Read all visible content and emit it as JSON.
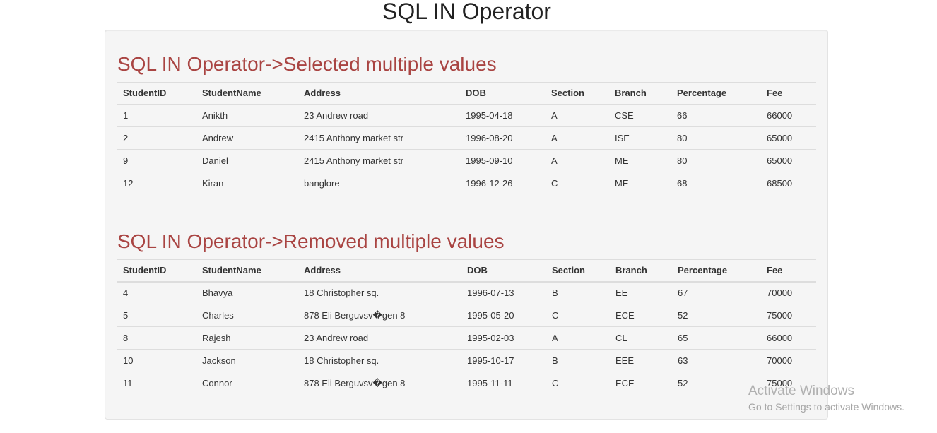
{
  "page": {
    "title": "SQL IN Operator"
  },
  "selected": {
    "heading": "SQL IN Operator->Selected multiple values",
    "columns": [
      "StudentID",
      "StudentName",
      "Address",
      "DOB",
      "Section",
      "Branch",
      "Percentage",
      "Fee"
    ],
    "rows": [
      [
        "1",
        "Anikth",
        "23 Andrew road",
        "1995-04-18",
        "A",
        "CSE",
        "66",
        "66000"
      ],
      [
        "2",
        "Andrew",
        "2415 Anthony market str",
        "1996-08-20",
        "A",
        "ISE",
        "80",
        "65000"
      ],
      [
        "9",
        "Daniel",
        "2415 Anthony market str",
        "1995-09-10",
        "A",
        "ME",
        "80",
        "65000"
      ],
      [
        "12",
        "Kiran",
        "banglore",
        "1996-12-26",
        "C",
        "ME",
        "68",
        "68500"
      ]
    ]
  },
  "removed": {
    "heading": "SQL IN Operator->Removed multiple values",
    "columns": [
      "StudentID",
      "StudentName",
      "Address",
      "DOB",
      "Section",
      "Branch",
      "Percentage",
      "Fee"
    ],
    "rows": [
      [
        "4",
        "Bhavya",
        "18 Christopher sq.",
        "1996-07-13",
        "B",
        "EE",
        "67",
        "70000"
      ],
      [
        "5",
        "Charles",
        "878 Eli Berguvsv�gen 8",
        "1995-05-20",
        "C",
        "ECE",
        "52",
        "75000"
      ],
      [
        "8",
        "Rajesh",
        "23 Andrew road",
        "1995-02-03",
        "A",
        "CL",
        "65",
        "66000"
      ],
      [
        "10",
        "Jackson",
        "18 Christopher sq.",
        "1995-10-17",
        "B",
        "EEE",
        "63",
        "70000"
      ],
      [
        "11",
        "Connor",
        "878 Eli Berguvsv�gen 8",
        "1995-11-11",
        "C",
        "ECE",
        "52",
        "75000"
      ]
    ]
  },
  "watermark": {
    "title": "Activate Windows",
    "subtitle": "Go to Settings to activate Windows."
  },
  "colors": {
    "heading": "#a94442",
    "panel_background": "#f5f5f5",
    "row_border": "#dddddd"
  }
}
